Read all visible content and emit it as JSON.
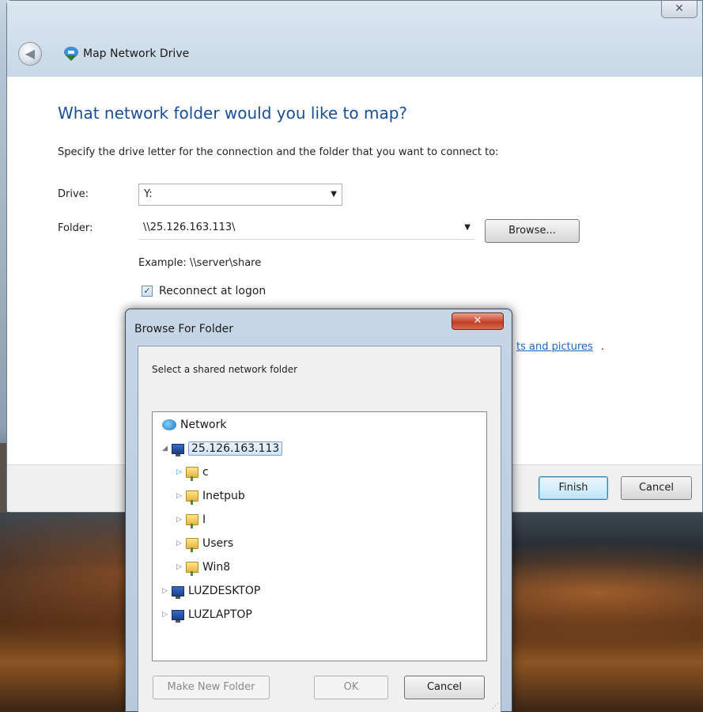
{
  "wizard": {
    "title": "Map Network Drive",
    "close_glyph": "✕",
    "back_glyph": "◀",
    "heading": "What network folder would you like to map?",
    "instruction": "Specify the drive letter for the connection and the folder that you want to connect to:",
    "drive_label": "Drive:",
    "drive_value": "Y:",
    "folder_label": "Folder:",
    "folder_value": "\\\\25.126.163.113\\",
    "dropdown_glyph": "▼",
    "browse_label": "Browse...",
    "example": "Example: \\\\server\\share",
    "reconnect_label": "Reconnect at logon",
    "reconnect_checked": true,
    "check_glyph": "✓",
    "link_fragment": "ts and pictures",
    "link_dot": ".",
    "finish_label": "Finish",
    "cancel_label": "Cancel"
  },
  "browse_dialog": {
    "title": "Browse For Folder",
    "close_glyph": "✕",
    "instruction": "Select a shared network folder",
    "tree": {
      "network": "Network",
      "host": "25.126.163.113",
      "host_children": [
        "c",
        "Inetpub",
        "I",
        "Users",
        "Win8"
      ],
      "other_hosts": [
        "LUZDESKTOP",
        "LUZLAPTOP"
      ]
    },
    "expander_open": "◢",
    "expander_closed": "▷",
    "make_new_folder_label": "Make New Folder",
    "ok_label": "OK",
    "cancel_label": "Cancel",
    "grip_glyph": "⋰"
  },
  "colors": {
    "heading": "#1b4e97",
    "link": "#1a66c2",
    "dialog_close": "#c03e22",
    "selection": "#cfe4fa"
  },
  "icons": [
    "back-arrow-icon",
    "network-drive-icon",
    "close-icon",
    "dropdown-arrow-icon",
    "checkbox-icon",
    "network-icon",
    "computer-icon",
    "folder-icon",
    "expand-icon",
    "collapse-icon"
  ]
}
